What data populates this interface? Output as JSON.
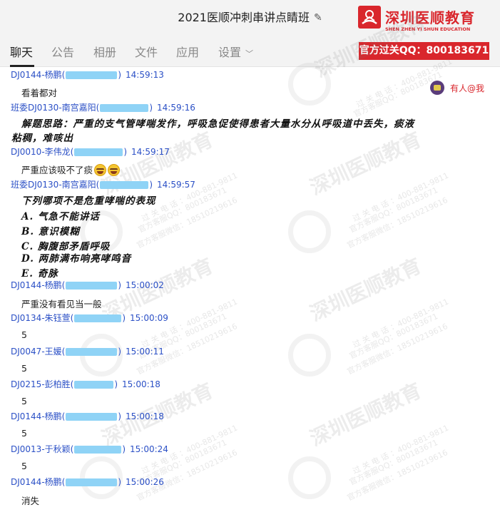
{
  "window": {
    "title": "2021医顺冲刺串讲点睛班"
  },
  "brand": {
    "name_cn": "深圳医顺教育",
    "name_en": "SHEN ZHEN YI SHUN EDUCATION",
    "color": "#d9262c"
  },
  "tabs": [
    {
      "label": "聊天",
      "active": true
    },
    {
      "label": "公告",
      "active": false
    },
    {
      "label": "相册",
      "active": false
    },
    {
      "label": "文件",
      "active": false
    },
    {
      "label": "应用",
      "active": false
    },
    {
      "label": "设置",
      "active": false
    }
  ],
  "promo": {
    "text": "官方过关QQ：800183671"
  },
  "notice": {
    "text": "有人@我"
  },
  "watermark": {
    "text": "深圳医顺教育",
    "phone": "过 关 电 话 ：400-881-9811",
    "qq": "官方客服QQ：800183671",
    "wechat": "官方客服微信：18510219616"
  },
  "messages": [
    {
      "sender": "DJ0144-杨鹏(",
      "close": ")",
      "time": "14:59:13",
      "lines": [
        "看着都对"
      ],
      "style": "normal"
    },
    {
      "sender": "班委DJ0130-南宫嘉阳(",
      "close": ")",
      "time": "14:59:16",
      "lines": [
        "解题思路：严重的支气管哮喘发作，呼吸急促使得患者大量水分从呼吸道中丢失，痰液",
        "粘稠，难咳出"
      ],
      "style": "bold"
    },
    {
      "sender": "DJ0010-李伟龙(",
      "close": ")",
      "time": "14:59:17",
      "lines": [
        "严重应该吸不了痰"
      ],
      "style": "normal",
      "emoji_count": 2
    },
    {
      "sender": "班委DJ0130-南宫嘉阳(",
      "close": ")",
      "time": "14:59:57",
      "lines": [
        "下列哪项不是危重哮喘的表现",
        "A. 气急不能讲话",
        "B. 意识模糊",
        "C. 胸腹部矛盾呼吸",
        "D. 两肺满布响亮哮鸣音",
        "E. 奇脉"
      ],
      "style": "bold"
    },
    {
      "sender": "DJ0144-杨鹏(",
      "close": ")",
      "time": "15:00:02",
      "lines": [
        "严重没有看见当一般"
      ],
      "style": "normal"
    },
    {
      "sender": "DJ0134-朱钰萱(",
      "close": ")",
      "time": "15:00:09",
      "lines": [
        "5"
      ],
      "style": "normal"
    },
    {
      "sender": "DJ0047-王媛(",
      "close": ")",
      "time": "15:00:11",
      "lines": [
        "5"
      ],
      "style": "normal"
    },
    {
      "sender": "DJ0215-彭柏胜(",
      "close": ")",
      "time": "15:00:18",
      "lines": [
        "5"
      ],
      "style": "normal"
    },
    {
      "sender": "DJ0144-杨鹏(",
      "close": ")",
      "time": "15:00:18",
      "lines": [
        "5"
      ],
      "style": "normal"
    },
    {
      "sender": "DJ0013-于秋颖(",
      "close": ")",
      "time": "15:00:24",
      "lines": [
        "5"
      ],
      "style": "normal"
    },
    {
      "sender": "DJ0144-杨鹏(",
      "close": ")",
      "time": "15:00:26",
      "lines": [
        "消失"
      ],
      "style": "normal"
    }
  ]
}
